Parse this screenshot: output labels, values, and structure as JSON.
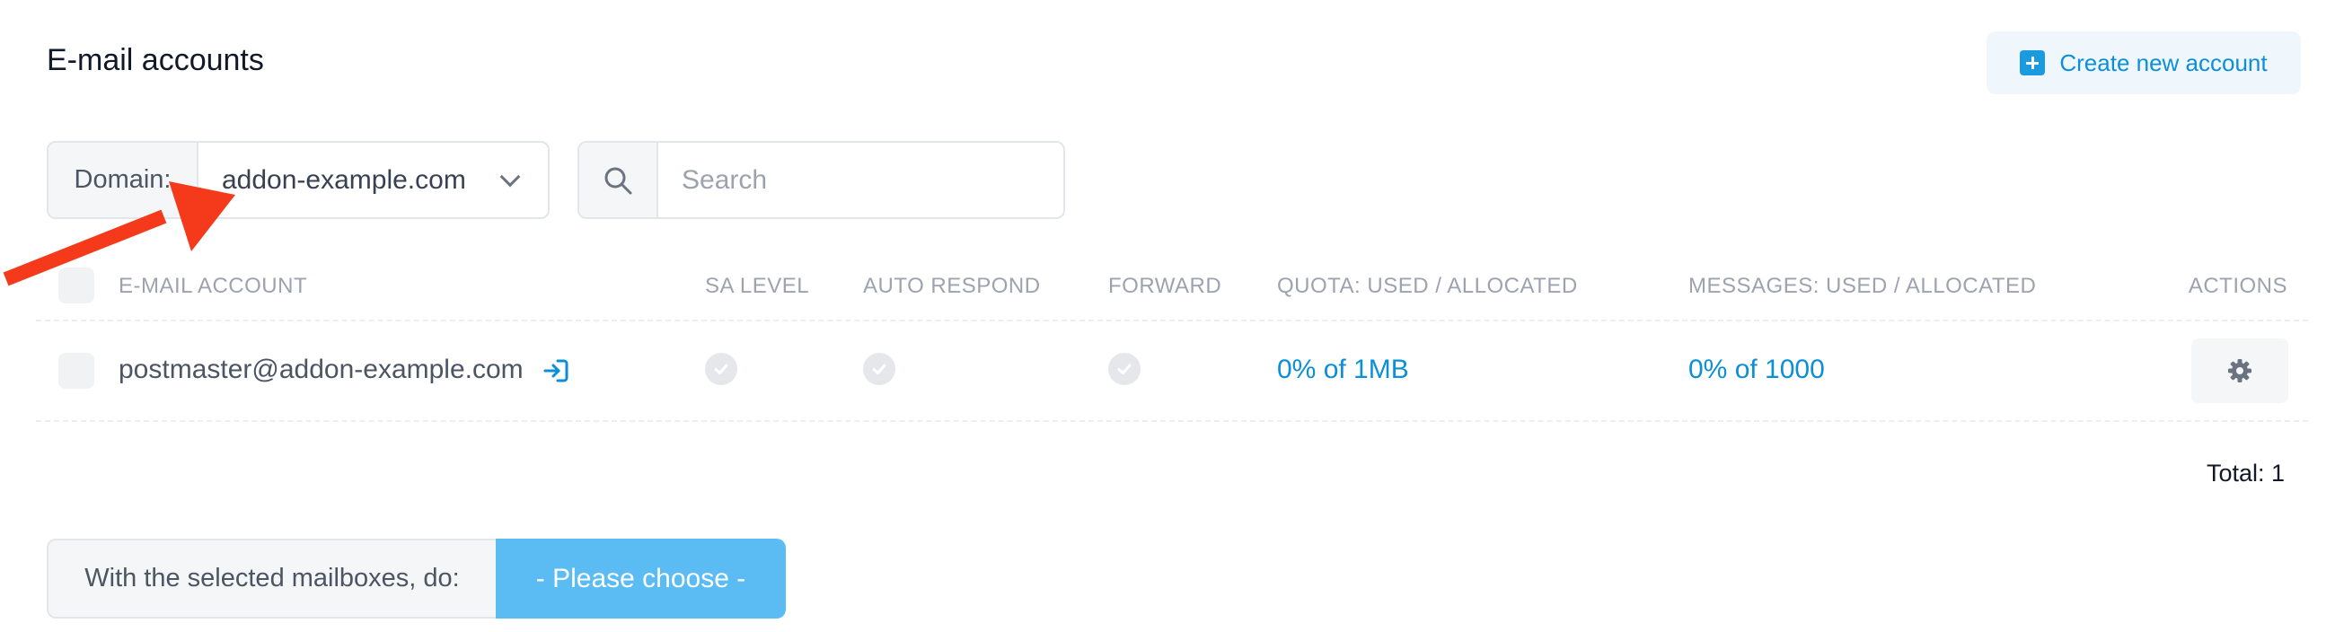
{
  "header": {
    "title": "E-mail accounts",
    "create_label": "Create new account"
  },
  "filters": {
    "domain_label": "Domain:",
    "domain_value": "addon-example.com",
    "search_placeholder": "Search"
  },
  "table": {
    "columns": {
      "email": "E-MAIL ACCOUNT",
      "sa_level": "SA LEVEL",
      "auto_respond": "AUTO RESPOND",
      "forward": "FORWARD",
      "quota": "QUOTA:  USED / ALLOCATED",
      "messages": "MESSAGES:  USED / ALLOCATED",
      "actions": "ACTIONS"
    },
    "rows": [
      {
        "email": "postmaster@addon-example.com",
        "quota": "0% of 1MB",
        "messages": "0% of 1000"
      }
    ],
    "total": "Total: 1"
  },
  "bulk": {
    "label": "With the selected mailboxes, do:",
    "choose_label": "- Please choose -"
  },
  "colors": {
    "accent": "#0b8fd6",
    "choose_button": "#5bbcf3",
    "annotation_arrow": "#f53a1b"
  },
  "icons": [
    "plus-icon",
    "chevron-down-icon",
    "search-icon",
    "login-icon",
    "check-icon",
    "gear-icon",
    "annotation-arrow"
  ]
}
